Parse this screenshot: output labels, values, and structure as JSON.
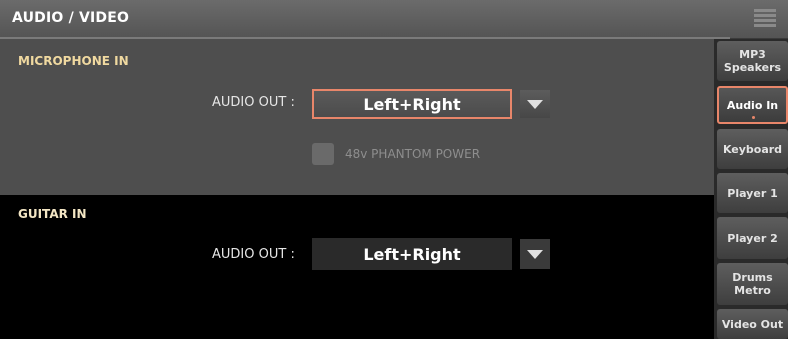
{
  "header": {
    "title": "AUDIO / VIDEO",
    "menu_icon": "hamburger-menu-icon"
  },
  "microphone": {
    "section_title": "MICROPHONE IN",
    "audio_out_label": "AUDIO OUT :",
    "audio_out_value": "Left+Right",
    "phantom_power_label": "48v PHANTOM POWER",
    "phantom_power_checked": false,
    "phantom_power_enabled": false
  },
  "guitar": {
    "section_title": "GUITAR IN",
    "audio_out_label": "AUDIO OUT :",
    "audio_out_value": "Left+Right"
  },
  "tabs": [
    {
      "label": "MP3\nSpeakers",
      "active": false
    },
    {
      "label": "Audio In",
      "active": true
    },
    {
      "label": "Keyboard",
      "active": false
    },
    {
      "label": "Player 1",
      "active": false
    },
    {
      "label": "Player 2",
      "active": false
    },
    {
      "label": "Drums\nMetro",
      "active": false
    },
    {
      "label": "Video Out",
      "active": false
    }
  ],
  "colors": {
    "accent": "#e8866a",
    "section_title": "#f0d9a0",
    "panel_bg": "#4e4e4e"
  }
}
